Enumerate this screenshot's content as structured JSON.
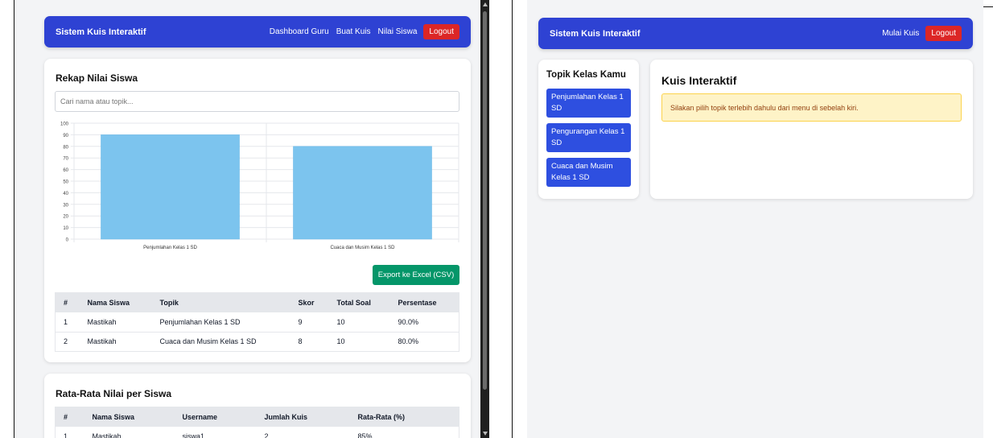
{
  "left": {
    "navbar": {
      "brand": "Sistem Kuis Interaktif",
      "links": [
        "Dashboard Guru",
        "Buat Kuis",
        "Nilai Siswa"
      ],
      "logout": "Logout"
    },
    "rekap": {
      "title": "Rekap Nilai Siswa",
      "search_placeholder": "Cari nama atau topik...",
      "export_label": "Export ke Excel (CSV)",
      "columns": [
        "#",
        "Nama Siswa",
        "Topik",
        "Skor",
        "Total Soal",
        "Persentase"
      ],
      "rows": [
        [
          "1",
          "Mastikah",
          "Penjumlahan Kelas 1 SD",
          "9",
          "10",
          "90.0%"
        ],
        [
          "2",
          "Mastikah",
          "Cuaca dan Musim Kelas 1 SD",
          "8",
          "10",
          "80.0%"
        ]
      ]
    },
    "rata": {
      "title": "Rata-Rata Nilai per Siswa",
      "columns": [
        "#",
        "Nama Siswa",
        "Username",
        "Jumlah Kuis",
        "Rata-Rata (%)"
      ],
      "rows": [
        [
          "1",
          "Mastikah",
          "siswa1",
          "2",
          "85%"
        ]
      ]
    }
  },
  "right": {
    "navbar": {
      "brand": "Sistem Kuis Interaktif",
      "links": [
        "Mulai Kuis"
      ],
      "logout": "Logout"
    },
    "sidebar": {
      "title": "Topik Kelas Kamu",
      "items": [
        "Penjumlahan Kelas 1 SD",
        "Pengurangan Kelas 1 SD",
        "Cuaca dan Musim Kelas 1 SD"
      ]
    },
    "main": {
      "title": "Kuis Interaktif",
      "alert": "Silakan pilih topik terlebih dahulu dari menu di sebelah kiri."
    }
  },
  "chart_data": {
    "type": "bar",
    "categories": [
      "Penjumlahan Kelas 1 SD",
      "Cuaca dan Musim Kelas 1 SD"
    ],
    "values": [
      90,
      80
    ],
    "ylim": [
      0,
      100
    ],
    "yticks": [
      "0",
      "10",
      "20",
      "30",
      "40",
      "50",
      "60",
      "70",
      "80",
      "90",
      "100"
    ],
    "bar_color": "#7cc4ee",
    "grid": true
  },
  "colors": {
    "navbar": "#2e42d3",
    "logout": "#dc2626",
    "export": "#059669",
    "sidebar_button": "#2e4fe0",
    "alert_bg": "#fef3c7"
  }
}
